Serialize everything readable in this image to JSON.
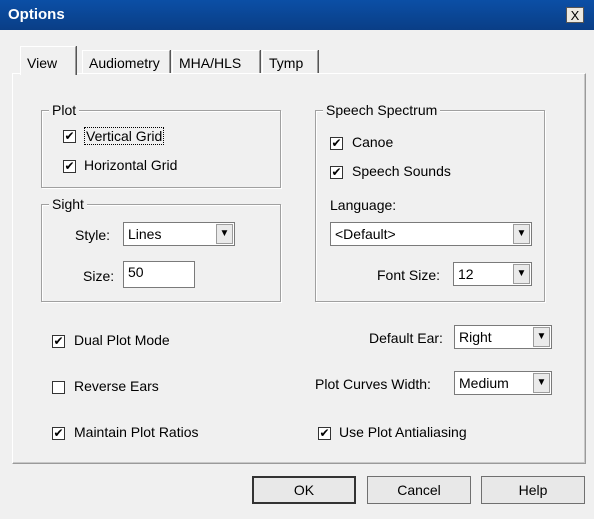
{
  "window": {
    "title": "Options",
    "close_glyph": "X"
  },
  "tabs": [
    {
      "label": "View"
    },
    {
      "label": "Audiometry"
    },
    {
      "label": "MHA/HLS"
    },
    {
      "label": "Tymp"
    }
  ],
  "plot_group": {
    "legend": "Plot",
    "vertical_grid": {
      "label": "Vertical Grid",
      "checked": true
    },
    "horizontal_grid": {
      "label": "Horizontal Grid",
      "checked": true
    }
  },
  "sight_group": {
    "legend": "Sight",
    "style_label": "Style:",
    "style_value": "Lines",
    "size_label": "Size:",
    "size_value": "50"
  },
  "speech_group": {
    "legend": "Speech Spectrum",
    "canoe": {
      "label": "Canoe",
      "checked": true
    },
    "speech_sounds": {
      "label": "Speech Sounds",
      "checked": true
    },
    "language_label": "Language:",
    "language_value": "<Default>",
    "font_size_label": "Font Size:",
    "font_size_value": "12"
  },
  "options": {
    "dual_plot_mode": {
      "label": "Dual Plot Mode",
      "checked": true
    },
    "reverse_ears": {
      "label": "Reverse Ears",
      "checked": false
    },
    "maintain_plot_ratios": {
      "label": "Maintain Plot Ratios",
      "checked": true
    },
    "use_plot_antialiasing": {
      "label": "Use Plot Antialiasing",
      "checked": true
    },
    "default_ear_label": "Default Ear:",
    "default_ear_value": "Right",
    "plot_curves_width_label": "Plot Curves Width:",
    "plot_curves_width_value": "Medium"
  },
  "buttons": {
    "ok": "OK",
    "cancel": "Cancel",
    "help": "Help"
  },
  "check_glyph": "✔",
  "arrow_glyph": "▼"
}
